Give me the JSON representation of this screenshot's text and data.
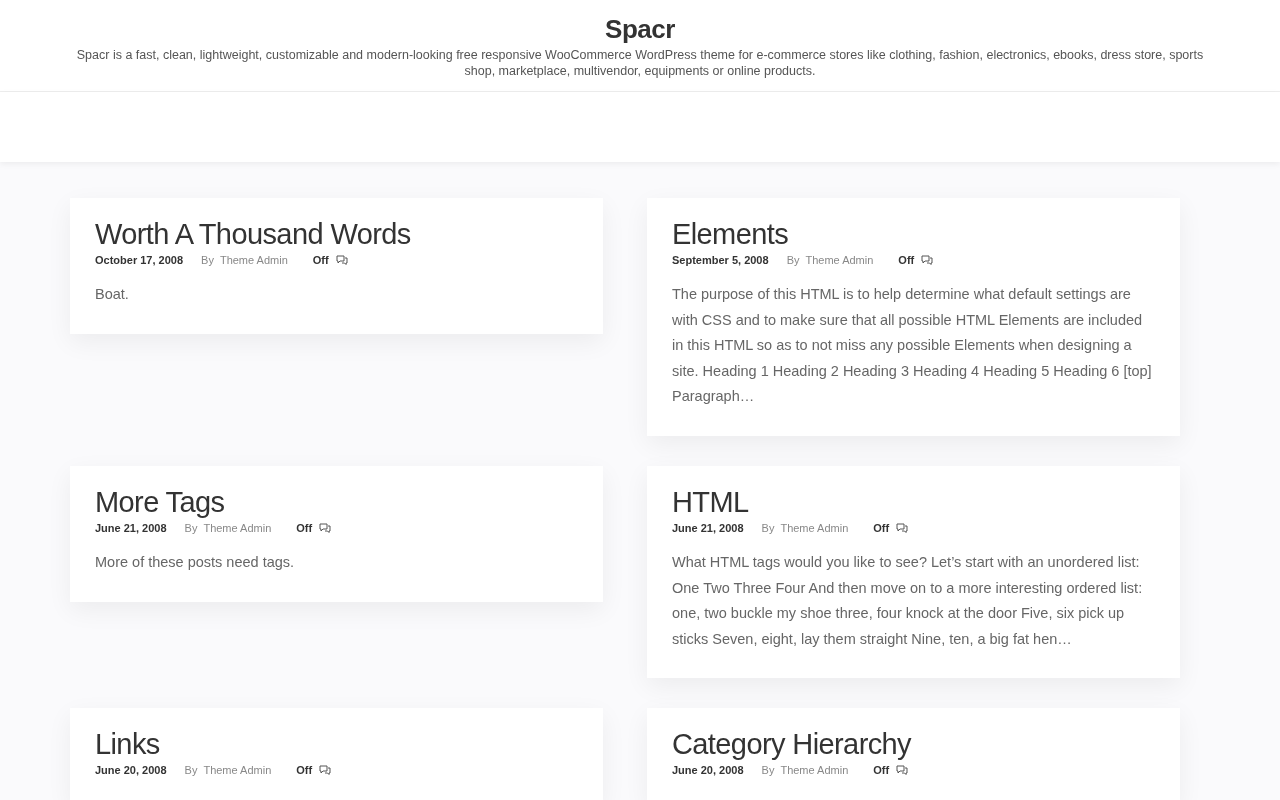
{
  "site": {
    "title": "Spacr",
    "tagline": "Spacr is a fast, clean, lightweight, customizable and modern-looking free responsive WooCommerce WordPress theme for e-commerce stores like clothing, fashion, electronics, ebooks, dress store, sports shop, marketplace, multivendor, equipments or online products."
  },
  "posts": [
    {
      "title": "Worth A Thousand Words",
      "date": "October 17, 2008",
      "by": "By",
      "author": "Theme Admin",
      "comments": "Off",
      "excerpt": "Boat."
    },
    {
      "title": "Elements",
      "date": "September 5, 2008",
      "by": "By",
      "author": "Theme Admin",
      "comments": "Off",
      "excerpt": "The purpose of this HTML is to help determine what default settings are with CSS and to make sure that all possible HTML Elements are included in this HTML so as to not miss any possible Elements when designing a site. Heading 1 Heading 2 Heading 3 Heading 4 Heading 5 Heading 6 [top] Paragraph…"
    },
    {
      "title": "More Tags",
      "date": "June 21, 2008",
      "by": "By",
      "author": "Theme Admin",
      "comments": "Off",
      "excerpt": "More of these posts need tags."
    },
    {
      "title": "HTML",
      "date": "June 21, 2008",
      "by": "By",
      "author": "Theme Admin",
      "comments": "Off",
      "excerpt": "What HTML tags would you like to see? Let’s start with an unordered list: One Two Three Four And then move on to a more interesting ordered list: one, two buckle my shoe three, four knock at the door Five, six pick up sticks Seven, eight, lay them straight Nine, ten, a big fat hen…"
    },
    {
      "title": "Links",
      "date": "June 20, 2008",
      "by": "By",
      "author": "Theme Admin",
      "comments": "Off"
    },
    {
      "title": "Category Hierarchy",
      "date": "June 20, 2008",
      "by": "By",
      "author": "Theme Admin",
      "comments": "Off"
    }
  ]
}
